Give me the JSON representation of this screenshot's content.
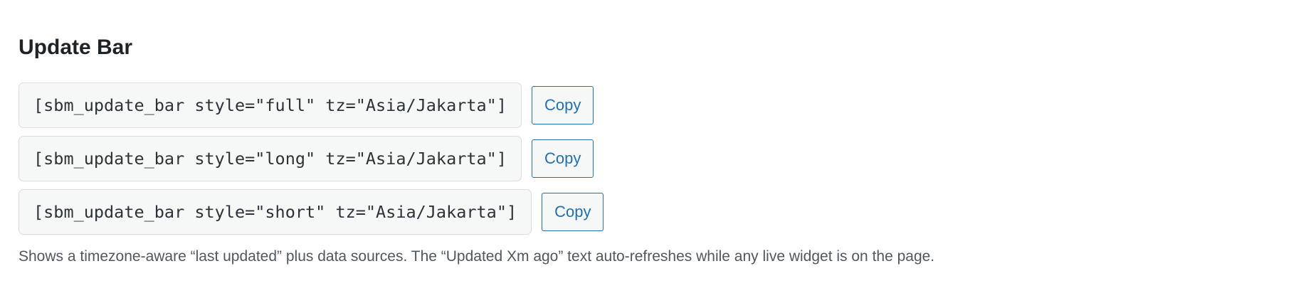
{
  "section": {
    "title": "Update Bar",
    "shortcodes": [
      {
        "code": "[sbm_update_bar style=\"full\" tz=\"Asia/Jakarta\"]",
        "button": "Copy"
      },
      {
        "code": "[sbm_update_bar style=\"long\" tz=\"Asia/Jakarta\"]",
        "button": "Copy"
      },
      {
        "code": "[sbm_update_bar style=\"short\" tz=\"Asia/Jakarta\"]",
        "button": "Copy"
      }
    ],
    "description": "Shows a timezone-aware “last updated” plus data sources. The “Updated Xm ago” text auto-refreshes while any live widget is on the page."
  }
}
